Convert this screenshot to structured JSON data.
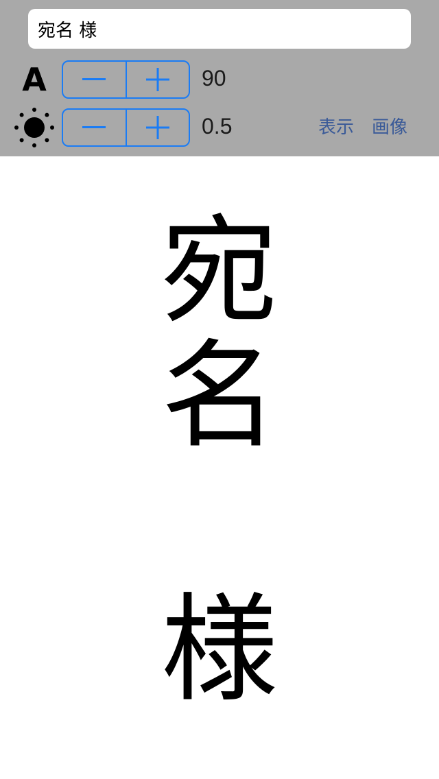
{
  "input": {
    "value": "宛名 様"
  },
  "font_size": {
    "icon_label": "A",
    "value": "90"
  },
  "brightness": {
    "value": "0.5"
  },
  "stepper": {
    "minus_label": "−",
    "plus_label": "+"
  },
  "actions": {
    "show_label": "表示",
    "image_label": "画像"
  },
  "preview": {
    "chars": [
      "宛",
      "名",
      "様"
    ]
  },
  "colors": {
    "accent": "#1a7cf5",
    "toolbar": "#a9a9a9",
    "link": "#3a5a98"
  }
}
